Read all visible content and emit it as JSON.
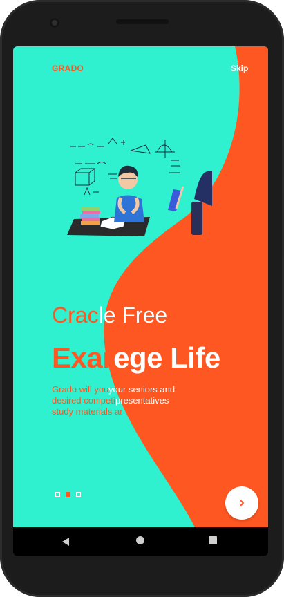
{
  "app": {
    "brand": "GRADO",
    "skip_label": "Skip"
  },
  "hero": {
    "title_line1_left": "Crac",
    "title_line1_right": "le Free",
    "title_line2_left": "Exar",
    "title_line2_right": "ege Life",
    "desc_lines": [
      {
        "left": "Grado will you",
        "right": "your seniors and"
      },
      {
        "left": "desired competi",
        "right": "presentatives"
      },
      {
        "left": "study materials ar",
        "right": ""
      }
    ]
  },
  "pager": {
    "pages": 3,
    "active_index": 1
  },
  "colors": {
    "teal": "#2ff0cf",
    "orange": "#ff5722",
    "white": "#ffffff"
  },
  "icons": {
    "next": "chevron-right-icon",
    "nav_back": "triangle-back-icon",
    "nav_home": "circle-home-icon",
    "nav_recent": "square-recent-icon"
  }
}
